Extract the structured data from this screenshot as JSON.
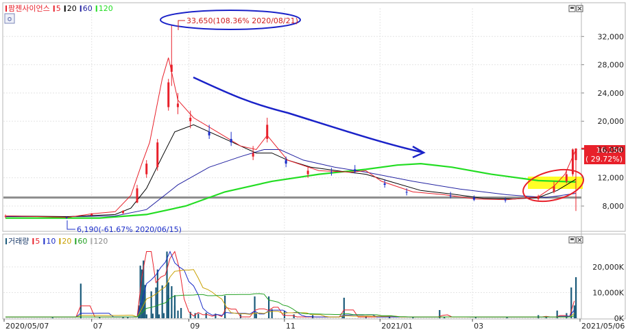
{
  "colors": {
    "up": "#e8202a",
    "down": "#1a2cc8",
    "ma5": "#e8202a",
    "ma10": "#1a2cc8",
    "ma20": "#000000",
    "ma20_vol": "#c8a000",
    "ma60": "#2020a0",
    "ma60_vol": "#22a022",
    "ma120": "#22dd22",
    "support": "#8c8c8c",
    "annotation_blue": "#1a22c8",
    "annotation_red": "#e8202a",
    "highlight": "#ffff00"
  },
  "icons": [
    "restore-icon",
    "close-icon",
    "settings-icon"
  ],
  "chart_data": [
    {
      "type": "candlestick",
      "legend": [
        {
          "label": "팜젠사이언스",
          "color": "#e8202a"
        },
        {
          "label": "5",
          "color": "#e8202a"
        },
        {
          "label": "20",
          "color": "#000000"
        },
        {
          "label": "60",
          "color": "#2020a0"
        },
        {
          "label": "120",
          "color": "#22dd22"
        }
      ],
      "y_ticks": [
        "32,000",
        "28,000",
        "24,000",
        "20,000",
        "16,000",
        "12,000",
        "8,000"
      ],
      "ylim": [
        5000,
        36000
      ],
      "xlim": [
        "2020/05/07",
        "2021/05/06"
      ],
      "support_level": 9200,
      "annotations": {
        "high": "33,650(108.36% 2020/08/21)",
        "high_value": 33650,
        "high_date": "2020/08/21",
        "low": "6,190(-61.67% 2020/06/15)",
        "low_value": 6190,
        "low_date": "2020/06/15"
      },
      "last_price": "16,150",
      "last_change": "( 29.72%)",
      "last_value": 16150,
      "ohlc": [
        [
          "2020-05-07",
          6500,
          6800,
          6300,
          6600
        ],
        [
          "2020-06-15",
          6400,
          6500,
          6190,
          6300
        ],
        [
          "2020-07-01",
          6700,
          7000,
          6600,
          6900
        ],
        [
          "2020-07-21",
          7000,
          7400,
          6900,
          7300
        ],
        [
          "2020-07-30",
          8500,
          11000,
          8400,
          10500
        ],
        [
          "2020-08-05",
          12500,
          14500,
          12000,
          14000
        ],
        [
          "2020-08-12",
          13500,
          17500,
          13000,
          17000
        ],
        [
          "2020-08-19",
          22000,
          26000,
          21500,
          25500
        ],
        [
          "2020-08-21",
          27000,
          33650,
          25000,
          28000
        ],
        [
          "2020-08-25",
          22000,
          24000,
          21000,
          22500
        ],
        [
          "2020-09-02",
          20000,
          21500,
          19000,
          20500
        ],
        [
          "2020-09-14",
          18500,
          19500,
          17500,
          18000
        ],
        [
          "2020-09-28",
          17500,
          18500,
          16500,
          17000
        ],
        [
          "2020-10-12",
          15000,
          16500,
          14500,
          15500
        ],
        [
          "2020-10-21",
          17500,
          20500,
          17000,
          19500
        ],
        [
          "2020-11-02",
          14500,
          15000,
          13500,
          14000
        ],
        [
          "2020-11-16",
          12500,
          13500,
          12000,
          13000
        ],
        [
          "2020-12-01",
          12800,
          13400,
          12300,
          12700
        ],
        [
          "2020-12-16",
          13200,
          13800,
          12600,
          12900
        ],
        [
          "2021-01-04",
          11200,
          11800,
          10600,
          11000
        ],
        [
          "2021-01-18",
          10000,
          10500,
          9500,
          9900
        ],
        [
          "2021-02-15",
          9500,
          10000,
          9100,
          9400
        ],
        [
          "2021-03-02",
          9200,
          9500,
          8700,
          8900
        ],
        [
          "2021-03-22",
          8900,
          9200,
          8500,
          8800
        ],
        [
          "2021-04-12",
          9000,
          9600,
          8800,
          9400
        ],
        [
          "2021-04-22",
          10000,
          11500,
          9800,
          10800
        ],
        [
          "2021-04-30",
          11500,
          13000,
          11200,
          12500
        ],
        [
          "2021-05-04",
          12500,
          16150,
          12200,
          16000
        ],
        [
          "2021-05-06",
          14500,
          16150,
          7300,
          16150
        ]
      ],
      "series": [
        {
          "name": "5",
          "values": [
            [
              0,
              6600
            ],
            [
              40,
              6400
            ],
            [
              55,
              6900
            ],
            [
              70,
              7200
            ],
            [
              80,
              9500
            ],
            [
              87,
              14000
            ],
            [
              92,
              17000
            ],
            [
              100,
              26000
            ],
            [
              104,
              29000
            ],
            [
              110,
              23000
            ],
            [
              120,
              20500
            ],
            [
              135,
              18500
            ],
            [
              150,
              16500
            ],
            [
              160,
              16000
            ],
            [
              167,
              18000
            ],
            [
              180,
              14500
            ],
            [
              200,
              13000
            ],
            [
              220,
              12800
            ],
            [
              230,
              13000
            ],
            [
              240,
              11500
            ],
            [
              260,
              10000
            ],
            [
              280,
              9600
            ],
            [
              300,
              9000
            ],
            [
              320,
              8900
            ],
            [
              340,
              9300
            ],
            [
              350,
              10800
            ],
            [
              357,
              12500
            ],
            [
              362,
              15000
            ],
            [
              364,
              16000
            ]
          ]
        },
        {
          "name": "20",
          "values": [
            [
              0,
              6600
            ],
            [
              40,
              6500
            ],
            [
              70,
              6800
            ],
            [
              80,
              7700
            ],
            [
              90,
              10500
            ],
            [
              100,
              15000
            ],
            [
              108,
              18500
            ],
            [
              120,
              19500
            ],
            [
              130,
              18500
            ],
            [
              145,
              17000
            ],
            [
              160,
              15500
            ],
            [
              170,
              15500
            ],
            [
              180,
              14500
            ],
            [
              195,
              13500
            ],
            [
              215,
              12900
            ],
            [
              230,
              12500
            ],
            [
              245,
              11500
            ],
            [
              265,
              10200
            ],
            [
              285,
              9700
            ],
            [
              305,
              9100
            ],
            [
              325,
              9000
            ],
            [
              340,
              9200
            ],
            [
              352,
              10200
            ],
            [
              364,
              11800
            ]
          ]
        },
        {
          "name": "60",
          "values": [
            [
              0,
              6500
            ],
            [
              40,
              6500
            ],
            [
              70,
              6600
            ],
            [
              90,
              7500
            ],
            [
              110,
              11000
            ],
            [
              130,
              13500
            ],
            [
              150,
              15000
            ],
            [
              165,
              16000
            ],
            [
              175,
              16000
            ],
            [
              190,
              14500
            ],
            [
              210,
              13500
            ],
            [
              230,
              12800
            ],
            [
              260,
              11500
            ],
            [
              290,
              10400
            ],
            [
              320,
              9600
            ],
            [
              345,
              9200
            ],
            [
              364,
              9800
            ]
          ]
        },
        {
          "name": "120",
          "values": [
            [
              0,
              6300
            ],
            [
              60,
              6300
            ],
            [
              90,
              6800
            ],
            [
              115,
              8000
            ],
            [
              140,
              10000
            ],
            [
              170,
              11500
            ],
            [
              200,
              12500
            ],
            [
              230,
              13200
            ],
            [
              250,
              13800
            ],
            [
              265,
              14000
            ],
            [
              285,
              13500
            ],
            [
              310,
              12500
            ],
            [
              340,
              11600
            ],
            [
              364,
              11400
            ]
          ]
        }
      ]
    },
    {
      "type": "bar",
      "legend": [
        {
          "label": "거래량",
          "color": "#1a5a7a"
        },
        {
          "label": "5",
          "color": "#e8202a"
        },
        {
          "label": "10",
          "color": "#1a2cc8"
        },
        {
          "label": "20",
          "color": "#c8a000"
        },
        {
          "label": "60",
          "color": "#22a022"
        },
        {
          "label": "120",
          "color": "#aaaaaa"
        }
      ],
      "y_ticks": [
        "20,000K",
        "10,000K",
        "0K"
      ],
      "ylim": [
        0,
        28000
      ],
      "x_ticks": [
        "2020/05/07",
        "07",
        "09",
        "11",
        "2021/01",
        "03",
        "2021/05/06"
      ],
      "volume": [
        [
          30,
          300
        ],
        [
          60,
          400
        ],
        [
          75,
          500
        ],
        [
          78,
          600
        ],
        [
          85,
          600
        ],
        [
          88,
          11000
        ],
        [
          90,
          1500
        ],
        [
          94,
          1800
        ],
        [
          98,
          1500
        ],
        [
          101,
          2000
        ],
        [
          104,
          9000
        ],
        [
          106,
          1500
        ],
        [
          108,
          5000
        ],
        [
          110,
          3000
        ],
        [
          112,
          4000
        ],
        [
          118,
          2500
        ],
        [
          121,
          2000
        ],
        [
          123,
          1800
        ],
        [
          128,
          2200
        ],
        [
          134,
          1800
        ],
        [
          140,
          1200
        ],
        [
          150,
          1500
        ],
        [
          160,
          1800
        ],
        [
          170,
          3500
        ],
        [
          178,
          3000
        ],
        [
          184,
          1500
        ],
        [
          196,
          1200
        ],
        [
          215,
          1000
        ],
        [
          230,
          800
        ],
        [
          245,
          700
        ],
        [
          260,
          600
        ],
        [
          280,
          500
        ],
        [
          300,
          500
        ],
        [
          320,
          600
        ],
        [
          340,
          1200
        ],
        [
          345,
          800
        ],
        [
          352,
          3000
        ],
        [
          358,
          2000
        ],
        [
          361,
          12000
        ],
        [
          363,
          5000
        ],
        [
          364,
          16000
        ]
      ],
      "volume_extra": [
        [
          48,
          13500
        ],
        [
          85,
          5000
        ],
        [
          86,
          20500
        ],
        [
          87,
          19000
        ],
        [
          88,
          22500
        ],
        [
          89,
          13000
        ],
        [
          93,
          10500
        ],
        [
          96,
          12000
        ],
        [
          97,
          19000
        ],
        [
          100,
          12800
        ],
        [
          103,
          26000
        ],
        [
          104,
          14000
        ],
        [
          106,
          12500
        ],
        [
          108,
          9000
        ],
        [
          140,
          8800
        ],
        [
          159,
          8500
        ],
        [
          168,
          8500
        ],
        [
          216,
          8000
        ],
        [
          277,
          3200
        ]
      ]
    }
  ]
}
